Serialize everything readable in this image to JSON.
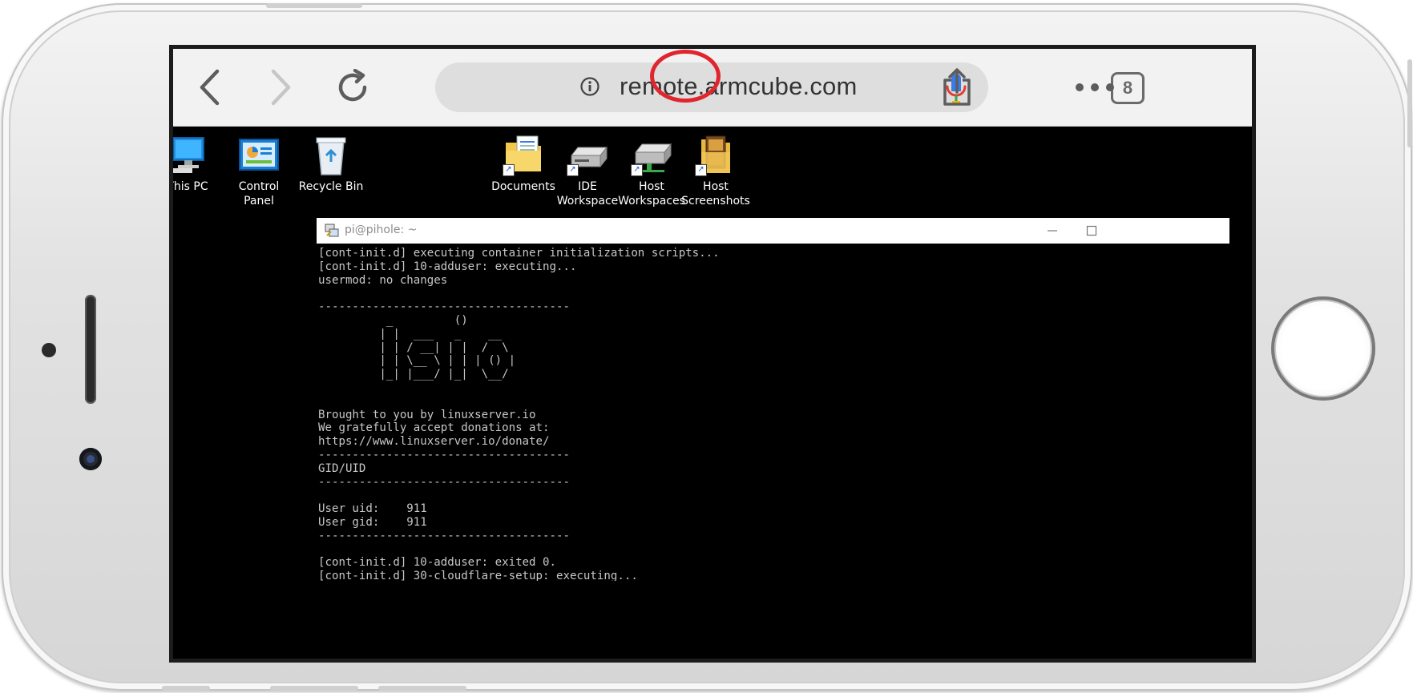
{
  "browser": {
    "url": "remote.armcube.com",
    "tab_count": "8"
  },
  "desktop": {
    "icons": [
      {
        "id": "this-pc",
        "label": "This PC"
      },
      {
        "id": "control-panel",
        "label": "Control Panel"
      },
      {
        "id": "recycle-bin",
        "label": "Recycle Bin"
      },
      {
        "id": "documents",
        "label": "Documents"
      },
      {
        "id": "ide-workspace",
        "label": "IDE\nWorkspace"
      },
      {
        "id": "host-workspaces",
        "label": "Host\nWorkspaces"
      },
      {
        "id": "host-screenshots",
        "label": "Host\nScreenshots"
      }
    ]
  },
  "terminal": {
    "title": "pi@pihole: ~",
    "lines": [
      "[cont-init.d] executing container initialization scripts...",
      "[cont-init.d] 10-adduser: executing...",
      "usermod: no changes",
      "",
      "-------------------------------------",
      "          _         ()",
      "         | |  ___   _    __",
      "         | | / __| | |  /  \\",
      "         | | \\__ \\ | | | () |",
      "         |_| |___/ |_|  \\__/",
      "",
      "",
      "Brought to you by linuxserver.io",
      "We gratefully accept donations at:",
      "https://www.linuxserver.io/donate/",
      "-------------------------------------",
      "GID/UID",
      "-------------------------------------",
      "",
      "User uid:    911",
      "User gid:    911",
      "-------------------------------------",
      "",
      "[cont-init.d] 10-adduser: exited 0.",
      "[cont-init.d] 30-cloudflare-setup: executing..."
    ]
  },
  "colors": {
    "highlight_circle": "#e1252e",
    "mic_blue": "#3b7be8",
    "terminal_bg": "#000000",
    "terminal_text": "#c7c7c7"
  }
}
